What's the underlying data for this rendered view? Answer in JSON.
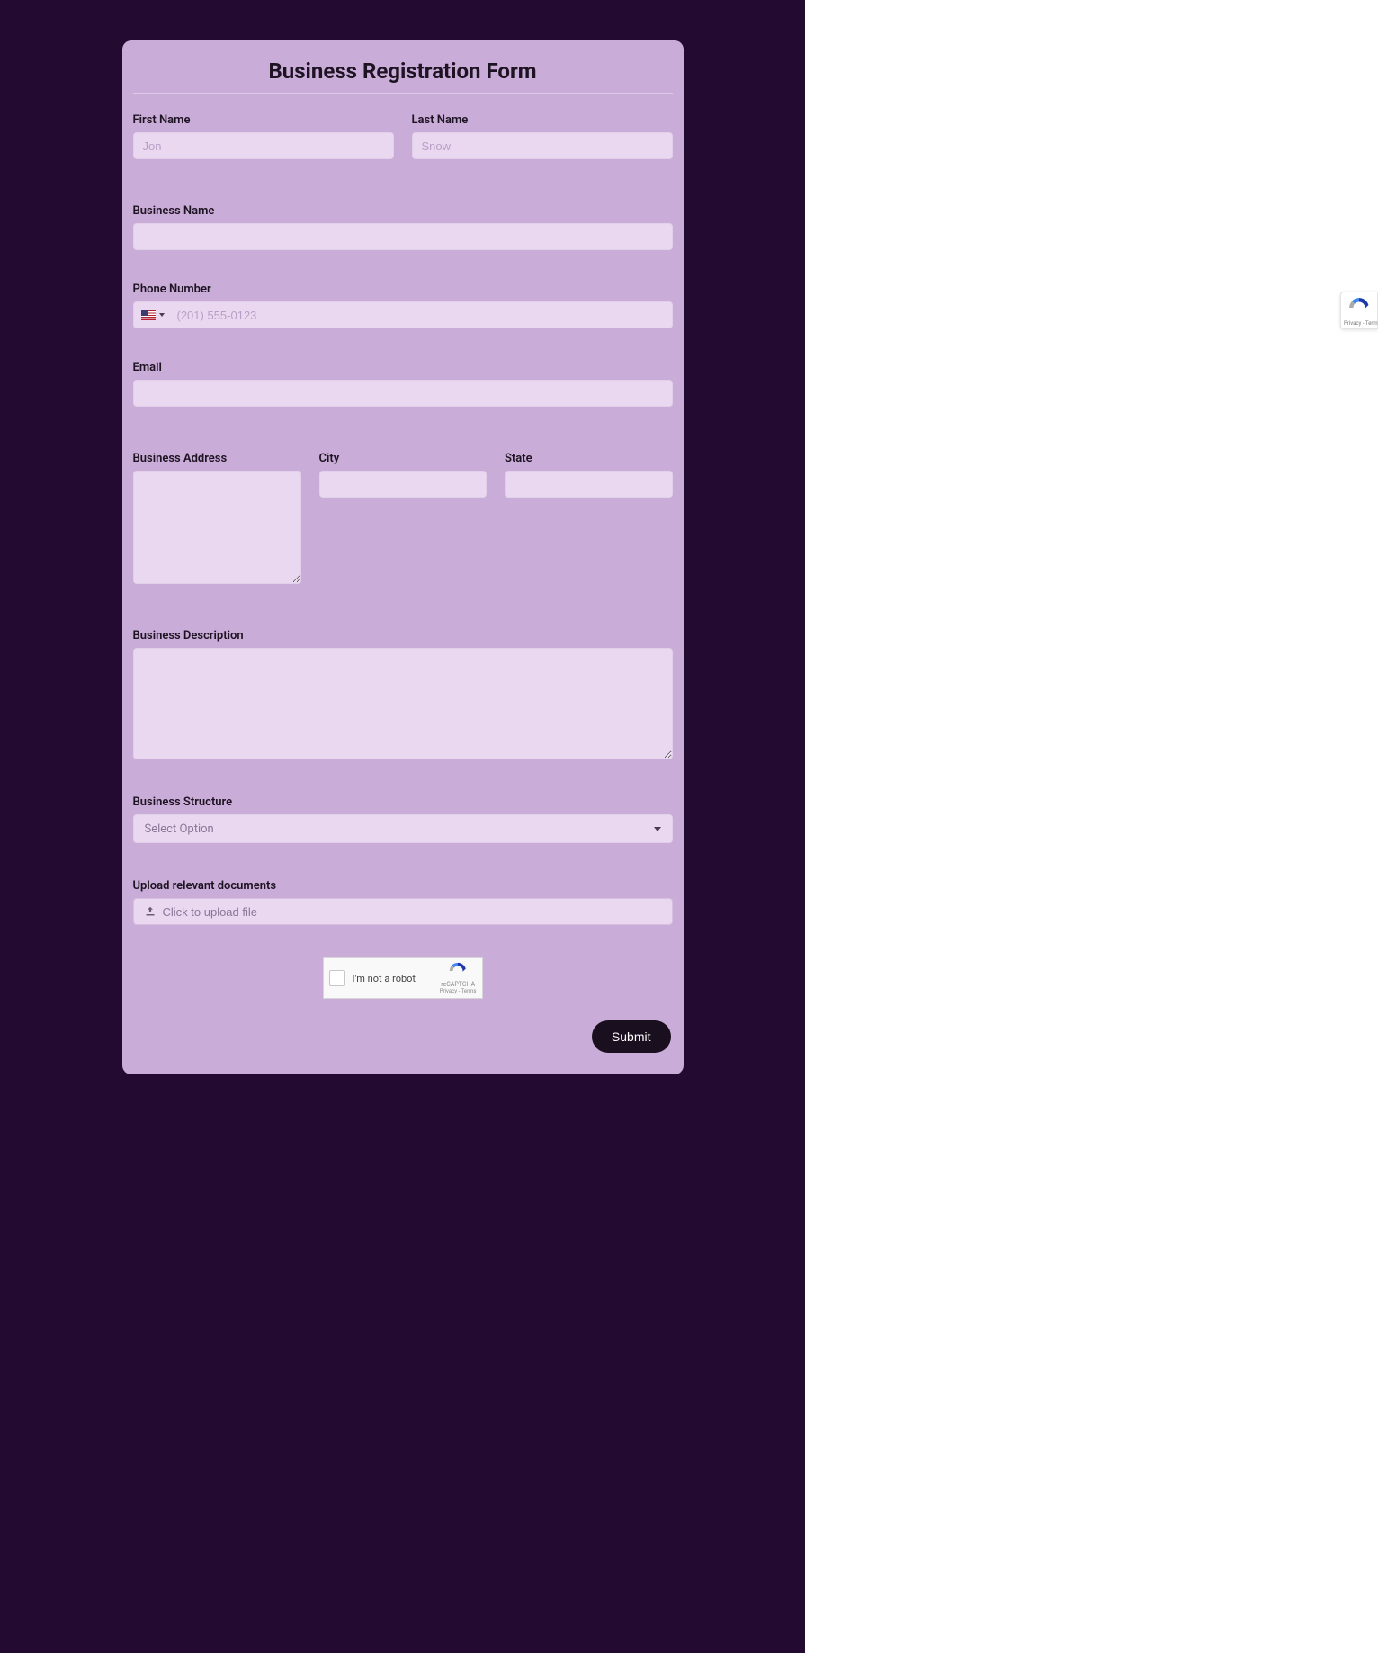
{
  "form": {
    "title": "Business Registration Form",
    "first_name_label": "First Name",
    "first_name_placeholder": "Jon",
    "last_name_label": "Last Name",
    "last_name_placeholder": "Snow",
    "business_name_label": "Business Name",
    "phone_label": "Phone Number",
    "phone_placeholder": "(201) 555-0123",
    "email_label": "Email",
    "address_label": "Business Address",
    "city_label": "City",
    "state_label": "State",
    "description_label": "Business Description",
    "structure_label": "Business Structure",
    "structure_placeholder": "Select Option",
    "upload_label": "Upload relevant documents",
    "upload_button": "Click to upload file",
    "submit_label": "Submit"
  },
  "captcha": {
    "text": "I'm not a robot",
    "brand": "reCAPTCHA",
    "links": "Privacy - Terms"
  }
}
